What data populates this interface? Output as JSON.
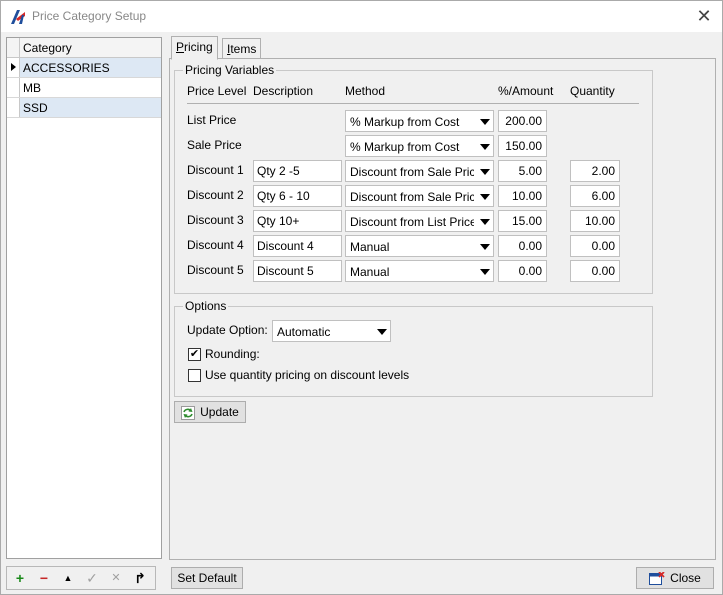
{
  "window": {
    "title": "Price Category Setup"
  },
  "grid": {
    "header": "Category",
    "rows": [
      {
        "name": "ACCESSORIES",
        "current": true
      },
      {
        "name": "MB"
      },
      {
        "name": "SSD"
      }
    ]
  },
  "nav": {
    "add": "+",
    "remove": "−",
    "up": "▲",
    "confirm": "✓",
    "cancel": "✕",
    "refresh": "↱"
  },
  "tabs": [
    {
      "label": "Pricing",
      "active": true
    },
    {
      "label": "Items"
    }
  ],
  "pricing": {
    "group_label": "Pricing Variables",
    "headers": {
      "level": "Price Level",
      "description": "Description",
      "method": "Method",
      "amount": "%/Amount",
      "quantity": "Quantity"
    },
    "rows": [
      {
        "level": "List Price",
        "description": "",
        "method": "% Markup from Cost",
        "amount": "200.00",
        "quantity": ""
      },
      {
        "level": "Sale Price",
        "description": "",
        "method": "% Markup from Cost",
        "amount": "150.00",
        "quantity": ""
      },
      {
        "level": "Discount 1",
        "description": "Qty 2 -5",
        "method": "Discount from Sale Price",
        "amount": "5.00",
        "quantity": "2.00"
      },
      {
        "level": "Discount 2",
        "description": "Qty 6 - 10",
        "method": "Discount from Sale Price",
        "amount": "10.00",
        "quantity": "6.00"
      },
      {
        "level": "Discount 3",
        "description": "Qty 10+",
        "method": "Discount from List Price",
        "amount": "15.00",
        "quantity": "10.00"
      },
      {
        "level": "Discount 4",
        "description": "Discount 4",
        "method": "Manual",
        "amount": "0.00",
        "quantity": "0.00"
      },
      {
        "level": "Discount 5",
        "description": "Discount 5",
        "method": "Manual",
        "amount": "0.00",
        "quantity": "0.00"
      }
    ]
  },
  "options": {
    "group_label": "Options",
    "update_option_label": "Update Option:",
    "update_option_value": "Automatic",
    "rounding_label": "Rounding:",
    "rounding_checked": true,
    "qty_pricing_label": "Use quantity pricing on discount levels",
    "qty_pricing_checked": false
  },
  "buttons": {
    "update": "Update",
    "set_default": "Set Default",
    "close": "Close"
  },
  "colors": {
    "accent_blue": "#1f4e9c",
    "row_alt": "#dde8f4",
    "brand_red": "#d62828"
  }
}
